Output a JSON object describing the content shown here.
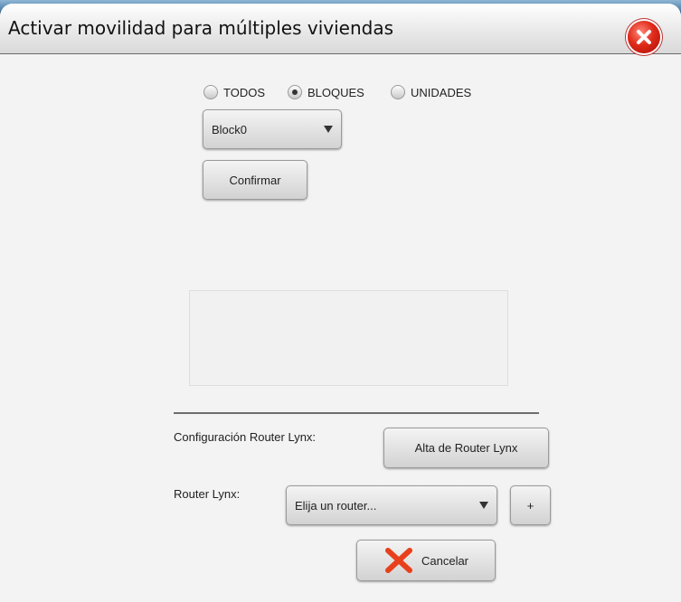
{
  "dialog": {
    "title": "Activar movilidad para múltiples viviendas",
    "close_icon": "close-icon"
  },
  "scope": {
    "options": [
      {
        "label": "TODOS",
        "checked": false
      },
      {
        "label": "BLOQUES",
        "checked": true
      },
      {
        "label": "UNIDADES",
        "checked": false
      }
    ]
  },
  "block_select": {
    "value": "Block0"
  },
  "confirm_label": "Confirmar",
  "router_config": {
    "label": "Configuración Router Lynx:",
    "add_button_label": "Alta de Router Lynx"
  },
  "router_select": {
    "label": "Router Lynx:",
    "value": "Elija un router...",
    "add_label": "+"
  },
  "cancel_label": "Cancelar",
  "colors": {
    "close_red": "#e02a1a",
    "cancel_icon_red": "#e8401c",
    "background": "#f3f3f3"
  }
}
